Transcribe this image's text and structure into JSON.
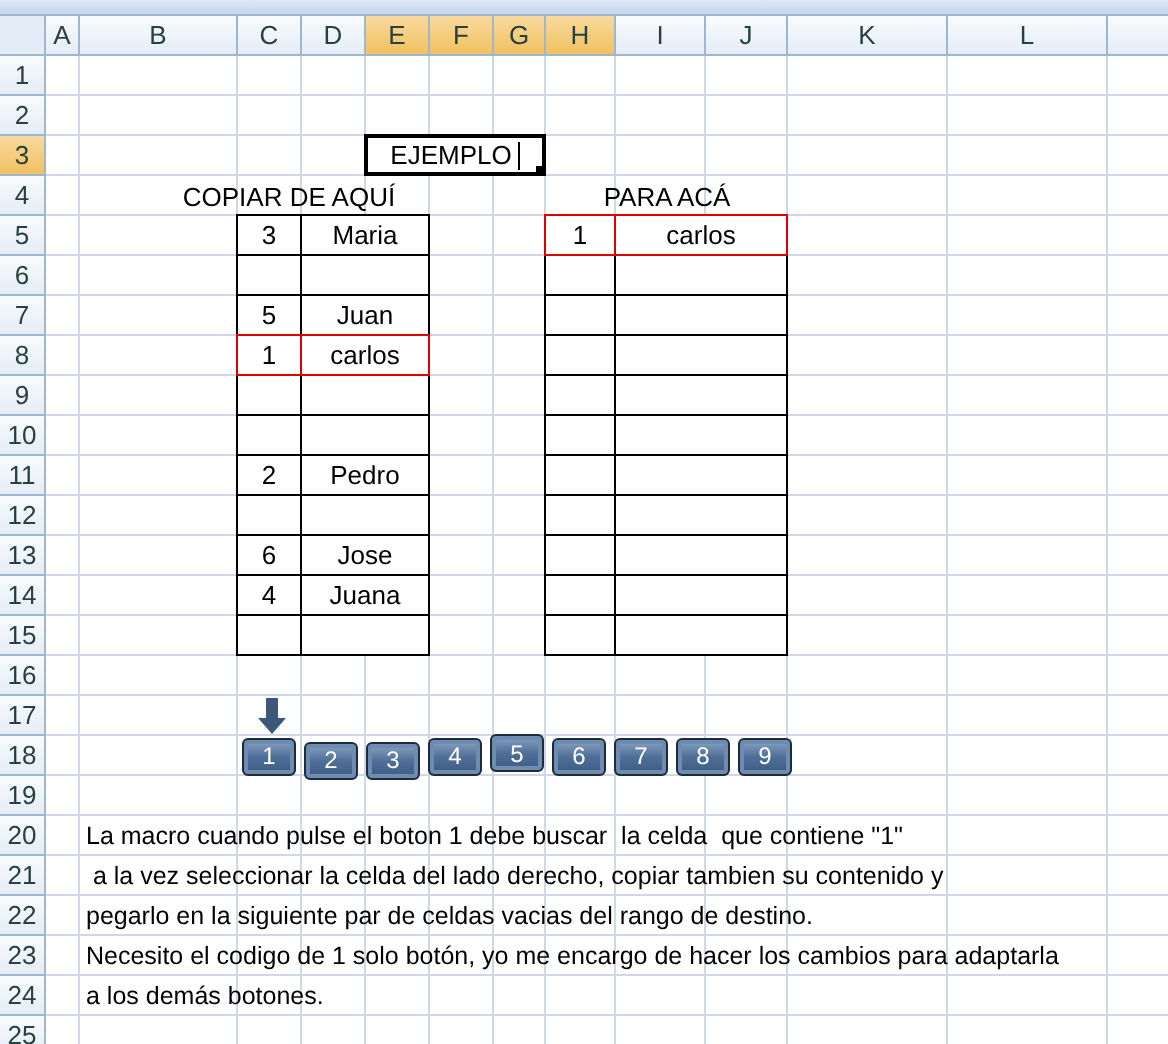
{
  "columns": [
    {
      "label": "A",
      "selected": false
    },
    {
      "label": "B",
      "selected": false
    },
    {
      "label": "C",
      "selected": false
    },
    {
      "label": "D",
      "selected": false
    },
    {
      "label": "E",
      "selected": true
    },
    {
      "label": "F",
      "selected": true
    },
    {
      "label": "G",
      "selected": true
    },
    {
      "label": "H",
      "selected": true
    },
    {
      "label": "I",
      "selected": false
    },
    {
      "label": "J",
      "selected": false
    },
    {
      "label": "K",
      "selected": false
    },
    {
      "label": "L",
      "selected": false
    }
  ],
  "rows": [
    {
      "label": "1",
      "selected": false
    },
    {
      "label": "2",
      "selected": false
    },
    {
      "label": "3",
      "selected": true
    },
    {
      "label": "4",
      "selected": false
    },
    {
      "label": "5",
      "selected": false
    },
    {
      "label": "6",
      "selected": false
    },
    {
      "label": "7",
      "selected": false
    },
    {
      "label": "8",
      "selected": false
    },
    {
      "label": "9",
      "selected": false
    },
    {
      "label": "10",
      "selected": false
    },
    {
      "label": "11",
      "selected": false
    },
    {
      "label": "12",
      "selected": false
    },
    {
      "label": "13",
      "selected": false
    },
    {
      "label": "14",
      "selected": false
    },
    {
      "label": "15",
      "selected": false
    },
    {
      "label": "16",
      "selected": false
    },
    {
      "label": "17",
      "selected": false
    },
    {
      "label": "18",
      "selected": false
    },
    {
      "label": "19",
      "selected": false
    },
    {
      "label": "20",
      "selected": false
    },
    {
      "label": "21",
      "selected": false
    },
    {
      "label": "22",
      "selected": false
    },
    {
      "label": "23",
      "selected": false
    },
    {
      "label": "24",
      "selected": false
    },
    {
      "label": "25",
      "selected": false
    }
  ],
  "active_cell": {
    "text": "EJEMPLO",
    "editing": true
  },
  "source_label": "COPIAR DE AQUÍ",
  "target_label": "PARA ACÁ",
  "source_table": [
    {
      "number": "3",
      "name": "Maria",
      "highlighted": false
    },
    {
      "highlighted": false
    },
    {
      "number": "5",
      "name": "Juan",
      "highlighted": false
    },
    {
      "number": "1",
      "name": "carlos",
      "highlighted": true
    },
    {
      "highlighted": false
    },
    {
      "highlighted": false
    },
    {
      "number": "2",
      "name": "Pedro",
      "highlighted": false
    },
    {
      "highlighted": false
    },
    {
      "number": "6",
      "name": "Jose",
      "highlighted": false
    },
    {
      "number": "4",
      "name": "Juana",
      "highlighted": false
    },
    {
      "highlighted": false
    }
  ],
  "target_table": [
    {
      "number": "1",
      "name": "carlos",
      "highlighted": true
    },
    {
      "highlighted": false
    },
    {
      "highlighted": false
    },
    {
      "highlighted": false
    },
    {
      "highlighted": false
    },
    {
      "highlighted": false
    },
    {
      "highlighted": false
    },
    {
      "highlighted": false
    },
    {
      "highlighted": false
    },
    {
      "highlighted": false
    },
    {
      "highlighted": false
    }
  ],
  "buttons": [
    "1",
    "2",
    "3",
    "4",
    "5",
    "6",
    "7",
    "8",
    "9"
  ],
  "notes": [
    "La macro cuando pulse el boton 1 debe buscar  la celda  que contiene \"1\"",
    " a la vez seleccionar la celda del lado derecho, copiar tambien su contenido y",
    "pegarlo en la siguiente par de celdas vacias del rango de destino.",
    "Necesito el codigo de 1 solo botón, yo me encargo de hacer los cambios para adaptarla",
    "a los demás botones."
  ]
}
